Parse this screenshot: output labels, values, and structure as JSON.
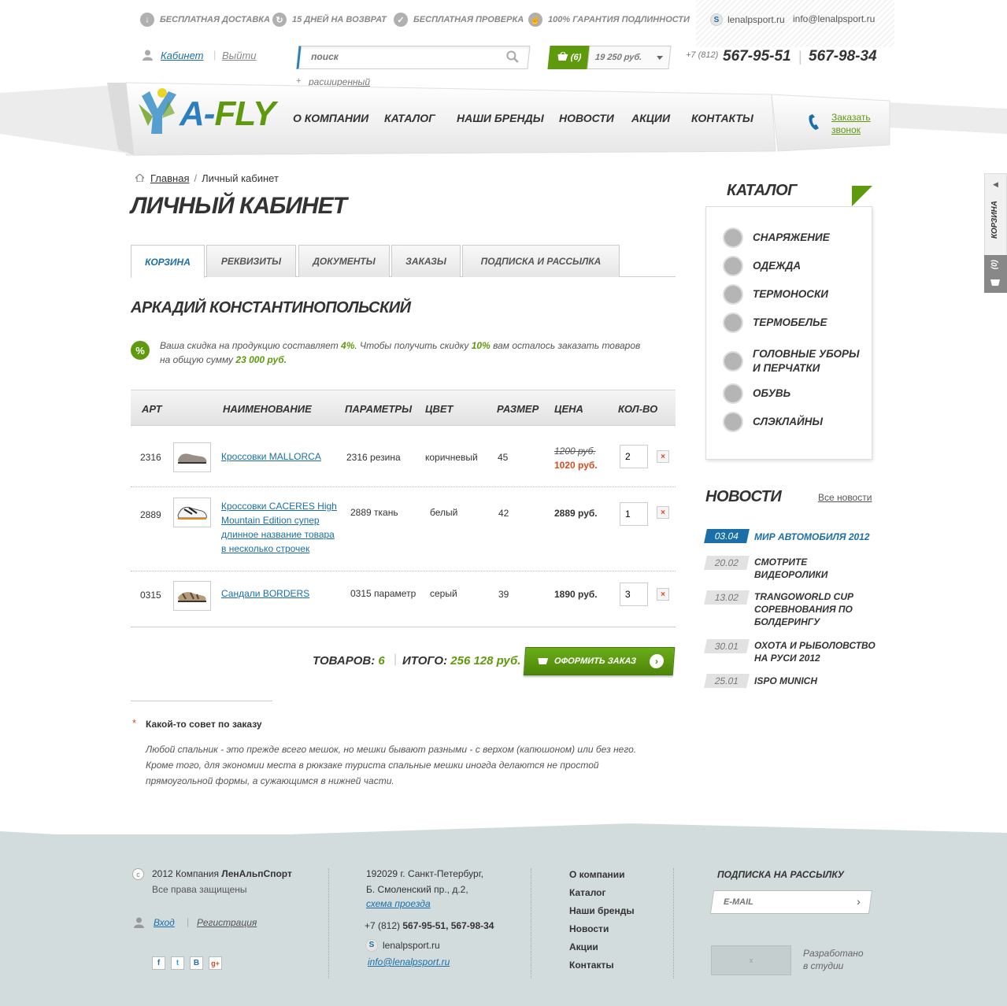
{
  "benefits": [
    {
      "icon": "arrow-down-icon",
      "label": "Бесплатная доставка"
    },
    {
      "icon": "return-icon",
      "label": "15 дней на возврат"
    },
    {
      "icon": "check-icon",
      "label": "Бесплатная проверка"
    },
    {
      "icon": "thumb-up-icon",
      "label": "100% гарантия подлинности"
    }
  ],
  "contacts_top": {
    "skype": "lenalpsport.ru",
    "email": "info@lenalpsport.ru"
  },
  "user": {
    "cabinet": "Кабинет",
    "logout": "Выйти"
  },
  "search": {
    "placeholder": "поиск",
    "advanced": "расширенный"
  },
  "cart_top": {
    "count": "(6)",
    "sum": "19 250 руб."
  },
  "phones": {
    "code": "+7 (812)",
    "phone1": "567-95-51",
    "phone2": "567-98-34"
  },
  "logo": {
    "a": "A",
    "dash": "-",
    "fly": "FLY"
  },
  "nav": [
    "О компании",
    "Каталог",
    "Наши бренды",
    "Новости",
    "Акции",
    "Контакты"
  ],
  "callback": {
    "line1": "Заказать",
    "line2": "звонок"
  },
  "breadcrumb": {
    "home": "Главная",
    "sep": "/",
    "current": "Личный кабинет"
  },
  "page_title": "Личный кабинет",
  "tabs": [
    "Корзина",
    "Реквизиты",
    "Документы",
    "Заказы",
    "Подписка и рассылка"
  ],
  "person_name": "Аркадий Константинопольский",
  "discount": {
    "icon": "%",
    "p1": "Ваша скидка на продукцию составляет ",
    "current": "4%",
    "p2": ". Чтобы получить скидку ",
    "next": "10%",
    "p3": " вам осталось заказать товаров",
    "p4": "на общую сумму ",
    "amount": "23 000 руб."
  },
  "table": {
    "headers": {
      "art": "Арт",
      "name": "Наименование",
      "params": "Параметры",
      "color": "Цвет",
      "size": "Размер",
      "price": "Цена",
      "qty": "Кол-во"
    },
    "rows": [
      {
        "art": "2316",
        "name": "Кроссовки MALLORCA",
        "params": "2316 резина",
        "color": "коричневый",
        "size": "45",
        "old_price": "1200 руб.",
        "price": "1020 руб.",
        "qty": "2",
        "delete": "×"
      },
      {
        "art": "2889",
        "name_lines": [
          "Кроссовки CACERES High",
          "Mountain Edition супер",
          "длинное название товара",
          "в несколько строчек"
        ],
        "params": "2889 ткань",
        "color": "белый",
        "size": "42",
        "price": "2889 руб.",
        "qty": "1",
        "delete": "×"
      },
      {
        "art": "0315",
        "name": "Сандали BORDERS",
        "params": "0315 параметр",
        "color": "серый",
        "size": "39",
        "price": "1890 руб.",
        "qty": "3",
        "delete": "×"
      }
    ]
  },
  "totals": {
    "goods_label": "Товаров:",
    "goods_count": "6",
    "total_label": "Итого:",
    "total_value": "256 128 руб.",
    "order_button": "Оформить заказ"
  },
  "tip": {
    "star": "*",
    "title": "Какой-то совет по заказу",
    "lines": [
      "Любой спальник  - это прежде всего мешок, но мешки бывают разными - с верхом (капюшоном) или без него.",
      "Кроме того, для экономии места в рюкзаке туриста спальные мешки иногда делаются не простой",
      "прямоугольной формы, а сужающимся в нижней части."
    ]
  },
  "catalog": {
    "title": "Каталог",
    "items": [
      {
        "icon": "tent-icon",
        "lines": [
          "Снаряжение"
        ]
      },
      {
        "icon": "jacket-icon",
        "lines": [
          "Одежда"
        ]
      },
      {
        "icon": "sock-icon",
        "lines": [
          "Термоноски"
        ]
      },
      {
        "icon": "tshirt-icon",
        "lines": [
          "Термобелье"
        ]
      },
      {
        "icon": "hat-icon",
        "lines": [
          "Головные уборы",
          "и перчатки"
        ]
      },
      {
        "icon": "shoe-icon",
        "lines": [
          "Обувь"
        ]
      },
      {
        "icon": "slackline-icon",
        "lines": [
          "Слэклайны"
        ]
      }
    ]
  },
  "news": {
    "title": "Новости",
    "all": "Все новости",
    "items": [
      {
        "date": "03.04",
        "lines": [
          "Мир автомобиля 2012"
        ]
      },
      {
        "date": "20.02",
        "lines": [
          "Смотрите",
          "видеоролики"
        ]
      },
      {
        "date": "13.02",
        "lines": [
          "Trangoworld Cup",
          "соревнования по",
          "болдерингу"
        ]
      },
      {
        "date": "30.01",
        "lines": [
          "Охота и рыболовство",
          "на Руси 2012"
        ]
      },
      {
        "date": "25.01",
        "lines": [
          "ISPO Munich"
        ]
      }
    ]
  },
  "side_cart": {
    "label": "Корзина",
    "count": "(0)"
  },
  "footer": {
    "copyright_icon": "c",
    "copyright_year": "2012 Компания ",
    "company": "ЛенАльпСпорт",
    "rights": "Все права защищены",
    "login": "Вход",
    "register": "Регистрация",
    "social": [
      {
        "icon": "facebook-icon",
        "glyph": "f"
      },
      {
        "icon": "twitter-icon",
        "glyph": "t"
      },
      {
        "icon": "vk-icon",
        "glyph": "В"
      },
      {
        "icon": "google-plus-icon",
        "glyph": "g+"
      }
    ],
    "address1": "192029 г. Санкт-Петербург,",
    "address2": "Б. Смоленский пр., д.2,",
    "map_link": "схема проезда",
    "phone_prefix": "+7 (812) ",
    "phones": "567-95-51, 567-98-34",
    "skype": "lenalpsport.ru",
    "email": "info@lenalpsport.ru",
    "menu": [
      "О компании",
      "Каталог",
      "Наши бренды",
      "Новости",
      "Акции",
      "Контакты"
    ],
    "subscribe_title": "Подписка на рассылку",
    "email_placeholder": "E-MAIL",
    "studio_line1": "Разработано",
    "studio_line2": "в студии",
    "studio_logo_mark": "x"
  },
  "colors": {
    "brand_blue": "#1a6fa8",
    "brand_green": "#5f9a0e",
    "old_price_red": "#d94a1e",
    "footer_bg": "#d3dcdd"
  }
}
